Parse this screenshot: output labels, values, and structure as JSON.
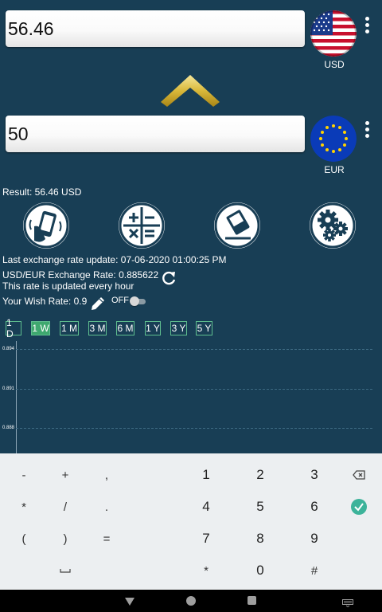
{
  "converter": {
    "from": {
      "amount": "56.46",
      "currency": "USD",
      "flag": "usa-flag-icon"
    },
    "to": {
      "amount": "50",
      "currency": "EUR",
      "flag": "eu-flag-icon"
    },
    "swap_icon": "chevron-up-icon"
  },
  "result_text": "Result: 56.46 USD",
  "tools": [
    "phone-shake-icon",
    "calculator-icon",
    "eraser-icon",
    "settings-gears-icon"
  ],
  "info": {
    "last_update": "Last exchange rate update: 07-06-2020 01:00:25 PM",
    "exchange_rate": "USD/EUR Exchange Rate: 0.885622",
    "update_note": "This rate is updated every hour",
    "wish_rate": "Your Wish Rate: 0.9",
    "wish_toggle": "OFF"
  },
  "periods": [
    "1 D",
    "1 W",
    "1 M",
    "3 M",
    "6 M",
    "1 Y",
    "3 Y",
    "5 Y"
  ],
  "active_period": "1 W",
  "chart_data": {
    "type": "line",
    "y_ticks": [
      "0.894",
      "0.891",
      "0.888"
    ],
    "series": []
  },
  "keyboard": {
    "rows": [
      [
        "-",
        "+",
        ",",
        "1",
        "2",
        "3",
        "backspace-icon"
      ],
      [
        "*",
        "/",
        ".",
        "4",
        "5",
        "6",
        "enter-check-icon"
      ],
      [
        "(",
        ")",
        "=",
        "7",
        "8",
        "9"
      ],
      [
        "space-icon",
        "*",
        "0",
        "#"
      ]
    ],
    "labels": {
      "r1": [
        "-",
        "+",
        ",",
        "1",
        "2",
        "3"
      ],
      "r2": [
        "*",
        "/",
        ".",
        "4",
        "5",
        "6"
      ],
      "r3": [
        "(",
        ")",
        "=",
        "7",
        "8",
        "9"
      ],
      "r4": [
        "⎵",
        "*",
        "0",
        "#"
      ]
    }
  },
  "nav": [
    "back-icon",
    "home-icon",
    "recents-icon",
    "keyboard-switch-icon"
  ]
}
